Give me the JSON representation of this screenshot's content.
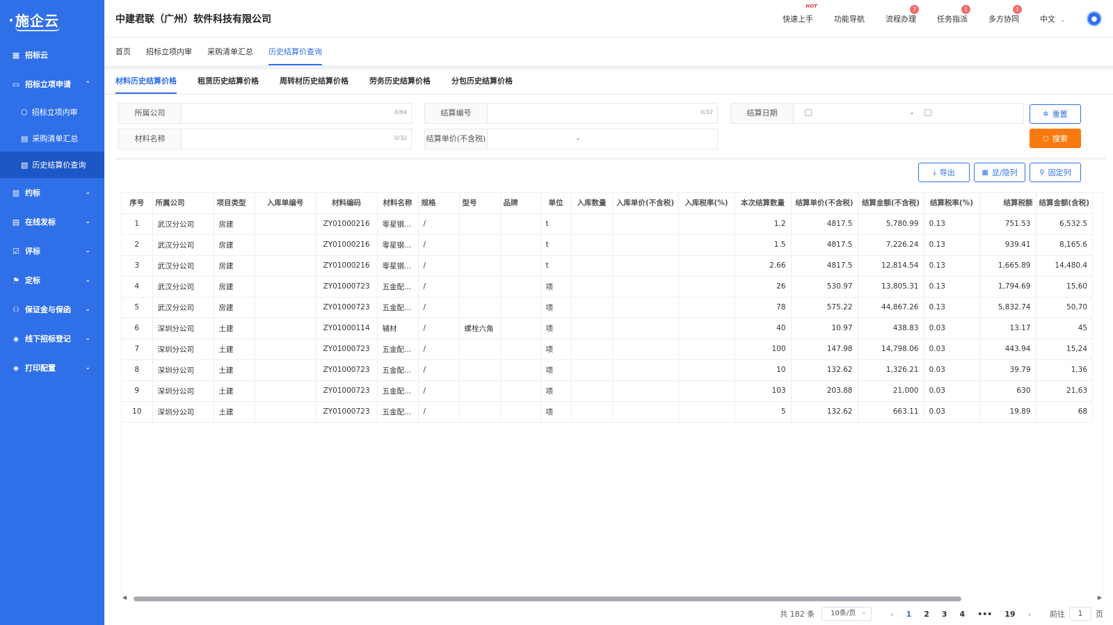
{
  "brand": {
    "name": "施企云"
  },
  "sidebar": {
    "items": [
      {
        "label": "招标云",
        "icon": "grid-icon"
      },
      {
        "label": "招标立项申请",
        "icon": "folder-icon",
        "expanded": true,
        "children": [
          {
            "label": "招标立项内审",
            "icon": "cube-icon"
          },
          {
            "label": "采购清单汇总",
            "icon": "table-icon"
          },
          {
            "label": "历史结算价查询",
            "icon": "history-doc-icon",
            "active": true
          }
        ]
      },
      {
        "label": "约标",
        "icon": "coins-icon"
      },
      {
        "label": "在线发标",
        "icon": "document-icon"
      },
      {
        "label": "评标",
        "icon": "checklist-icon"
      },
      {
        "label": "定标",
        "icon": "stamp-icon"
      },
      {
        "label": "保证金与保函",
        "icon": "org-icon"
      },
      {
        "label": "线下招标登记",
        "icon": "layers-icon"
      },
      {
        "label": "打印配置",
        "icon": "printer-icon"
      }
    ]
  },
  "header": {
    "company": "中建君联（广州）软件科技有限公司",
    "links": [
      {
        "label": "快速上手",
        "hot": "HOT"
      },
      {
        "label": "功能导航"
      },
      {
        "label": "流程办理",
        "badge": "7"
      },
      {
        "label": "任务指派",
        "badge": "1"
      },
      {
        "label": "多方协同",
        "badge": "1"
      }
    ],
    "language": "中文"
  },
  "nav_tabs": [
    "首页",
    "招标立项内审",
    "采购清单汇总",
    "历史结算价查询"
  ],
  "sub_tabs": [
    "材料历史结算价格",
    "租赁历史结算价格",
    "周转材历史结算价格",
    "劳务历史结算价格",
    "分包历史结算价格"
  ],
  "filters": {
    "company": {
      "label": "所属公司",
      "count": "0/64"
    },
    "settle_no": {
      "label": "结算编号",
      "count": "0/32"
    },
    "settle_date": {
      "label": "结算日期",
      "sep": "-"
    },
    "material_name": {
      "label": "材料名称",
      "count": "0/32"
    },
    "unit_price": {
      "label": "结算单价(不含税)",
      "sep": "-"
    }
  },
  "buttons": {
    "reset": "重置",
    "search": "搜索",
    "export": "导出",
    "toggle_cols": "显/隐列",
    "fix_cols": "固定列"
  },
  "table": {
    "columns": [
      "序号",
      "所属公司",
      "项目类型",
      "入库单编号",
      "材料编码",
      "材料名称",
      "规格",
      "型号",
      "品牌",
      "单位",
      "入库数量",
      "入库单价(不含税)",
      "入库税率(%)",
      "本次结算数量",
      "结算单价(不含税)",
      "结算金额(不含税)",
      "结算税率(%)",
      "结算税额",
      "结算金额(含税)"
    ],
    "rows": [
      [
        "1",
        "武汉分公司",
        "房建",
        "",
        "ZY01000216",
        "零星钢...",
        "/",
        "",
        "",
        "t",
        "",
        "",
        "",
        "1.2",
        "4817.5",
        "5,780.99",
        "0.13",
        "751.53",
        "6,532.5"
      ],
      [
        "2",
        "武汉分公司",
        "房建",
        "",
        "ZY01000216",
        "零星钢...",
        "/",
        "",
        "",
        "t",
        "",
        "",
        "",
        "1.5",
        "4817.5",
        "7,226.24",
        "0.13",
        "939.41",
        "8,165.6"
      ],
      [
        "3",
        "武汉分公司",
        "房建",
        "",
        "ZY01000216",
        "零星钢...",
        "/",
        "",
        "",
        "t",
        "",
        "",
        "",
        "2.66",
        "4817.5",
        "12,814.54",
        "0.13",
        "1,665.89",
        "14,480.4"
      ],
      [
        "4",
        "武汉分公司",
        "房建",
        "",
        "ZY01000723",
        "五金配...",
        "/",
        "",
        "",
        "项",
        "",
        "",
        "",
        "26",
        "530.97",
        "13,805.31",
        "0.13",
        "1,794.69",
        "15,60"
      ],
      [
        "5",
        "武汉分公司",
        "房建",
        "",
        "ZY01000723",
        "五金配...",
        "/",
        "",
        "",
        "项",
        "",
        "",
        "",
        "78",
        "575.22",
        "44,867.26",
        "0.13",
        "5,832.74",
        "50,70"
      ],
      [
        "6",
        "深圳分公司",
        "土建",
        "",
        "ZY01000114",
        "辅材",
        "/",
        "螺栓六角",
        "",
        "项",
        "",
        "",
        "",
        "40",
        "10.97",
        "438.83",
        "0.03",
        "13.17",
        "45"
      ],
      [
        "7",
        "深圳分公司",
        "土建",
        "",
        "ZY01000723",
        "五金配...",
        "/",
        "",
        "",
        "项",
        "",
        "",
        "",
        "100",
        "147.98",
        "14,798.06",
        "0.03",
        "443.94",
        "15,24"
      ],
      [
        "8",
        "深圳分公司",
        "土建",
        "",
        "ZY01000723",
        "五金配...",
        "/",
        "",
        "",
        "项",
        "",
        "",
        "",
        "10",
        "132.62",
        "1,326.21",
        "0.03",
        "39.79",
        "1,36"
      ],
      [
        "9",
        "深圳分公司",
        "土建",
        "",
        "ZY01000723",
        "五金配...",
        "/",
        "",
        "",
        "项",
        "",
        "",
        "",
        "103",
        "203.88",
        "21,000",
        "0.03",
        "630",
        "21,63"
      ],
      [
        "10",
        "深圳分公司",
        "土建",
        "",
        "ZY01000723",
        "五金配...",
        "/",
        "",
        "",
        "项",
        "",
        "",
        "",
        "5",
        "132.62",
        "663.11",
        "0.03",
        "19.89",
        "68"
      ]
    ]
  },
  "pagination": {
    "total": "共 182 条",
    "page_size": "10条/页",
    "pages": [
      "1",
      "2",
      "3",
      "4",
      "•••",
      "19"
    ],
    "current": "1",
    "goto_label": "前往",
    "goto_value": "1",
    "goto_suffix": "页"
  }
}
